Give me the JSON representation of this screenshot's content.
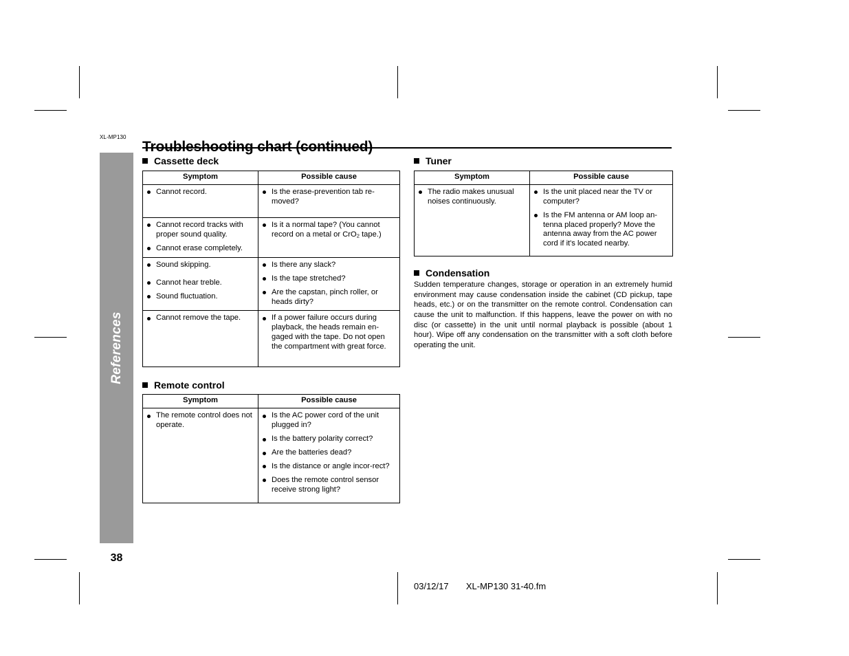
{
  "page": {
    "model_label": "XL-MP130",
    "side_tab_label": "References",
    "page_number": "38",
    "title": "Troubleshooting chart (continued)"
  },
  "columns": {
    "left": {
      "sections": [
        {
          "heading": "Cassette deck",
          "table": {
            "headers": [
              "Symptom",
              "Possible cause"
            ],
            "rows": [
              {
                "symptom": [
                  "Cannot record."
                ],
                "cause": [
                  "Is the erase-prevention tab re-moved?"
                ]
              },
              {
                "symptom": [
                  "Cannot record tracks with proper sound quality.",
                  "Cannot erase completely."
                ],
                "cause": [
                  "Is it a normal tape? (You cannot record on a metal or CrO2 tape.)"
                ]
              },
              {
                "symptom": [
                  "Sound skipping.",
                  "Cannot hear treble.",
                  "Sound fluctuation."
                ],
                "cause": [
                  "Is there any slack?",
                  "Is the tape stretched?",
                  "Are the capstan, pinch roller, or heads dirty?"
                ]
              },
              {
                "symptom": [
                  "Cannot remove the tape."
                ],
                "cause": [
                  "If a power failure occurs during playback, the heads remain en-gaged with the tape. Do not open the compartment with great force."
                ]
              }
            ]
          }
        },
        {
          "heading": "Remote control",
          "table": {
            "headers": [
              "Symptom",
              "Possible cause"
            ],
            "rows": [
              {
                "symptom": [
                  "The remote control does not operate."
                ],
                "cause": [
                  "Is the AC power cord of the unit plugged in?",
                  "Is the battery polarity correct?",
                  "Are the batteries dead?",
                  "Is the distance or angle incor-rect?",
                  "Does the remote control sensor receive strong light?"
                ]
              }
            ]
          }
        }
      ]
    },
    "right": {
      "sections": [
        {
          "heading": "Tuner",
          "table": {
            "headers": [
              "Symptom",
              "Possible cause"
            ],
            "rows": [
              {
                "symptom": [
                  "The radio makes unusual noises continuously."
                ],
                "cause": [
                  "Is the unit placed near the TV or computer?",
                  "Is the FM antenna or AM loop an-tenna placed properly? Move the antenna away from the AC power cord if it's located nearby."
                ]
              }
            ]
          }
        },
        {
          "heading": "Condensation",
          "body": "Sudden temperature changes, storage or operation in an extremely humid environment may cause condensation inside the cabinet (CD pickup, tape heads, etc.) or on the transmitter on the remote control. Condensation can cause the unit to malfunction. If this happens, leave the power on with no disc (or cassette) in the unit until normal playback is possible (about 1 hour). Wipe off any condensation on the transmitter with a soft cloth before operating the unit."
        }
      ]
    }
  },
  "footer": {
    "date": "03/12/17",
    "filename": "XL-MP130 31-40.fm"
  },
  "colors": {
    "side_tab_gray": "#9a9a9a",
    "text": "#000000",
    "page_background": "#ffffff"
  }
}
